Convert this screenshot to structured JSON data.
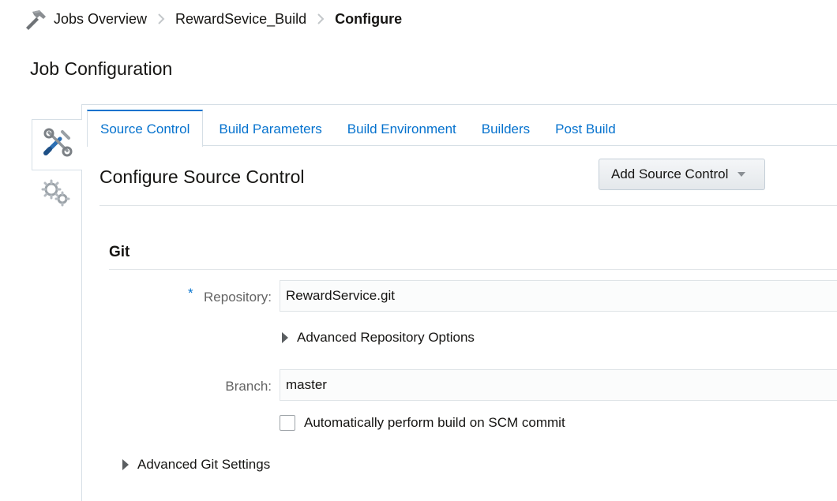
{
  "breadcrumb": {
    "icon": "hammer-icon",
    "items": [
      "Jobs Overview",
      "RewardSevice_Build",
      "Configure"
    ]
  },
  "page_title": "Job Configuration",
  "side_tabs": {
    "active_icon": "tools-icon",
    "inactive_icon": "gears-icon"
  },
  "tabs": [
    "Source Control",
    "Build Parameters",
    "Build Environment",
    "Builders",
    "Post Build"
  ],
  "active_tab": "Source Control",
  "section": {
    "heading": "Configure Source Control",
    "add_button_label": "Add Source Control"
  },
  "git": {
    "title": "Git",
    "repository_label": "Repository:",
    "repository_required": "*",
    "repository_value": "RewardService.git",
    "advanced_repo_label": "Advanced Repository Options",
    "branch_label": "Branch:",
    "branch_value": "master",
    "auto_build_label": "Automatically perform build on SCM commit",
    "auto_build_checked": false,
    "advanced_git_label": "Advanced Git Settings"
  },
  "colors": {
    "accent": "#0572ce",
    "border": "#d6dfe6"
  }
}
